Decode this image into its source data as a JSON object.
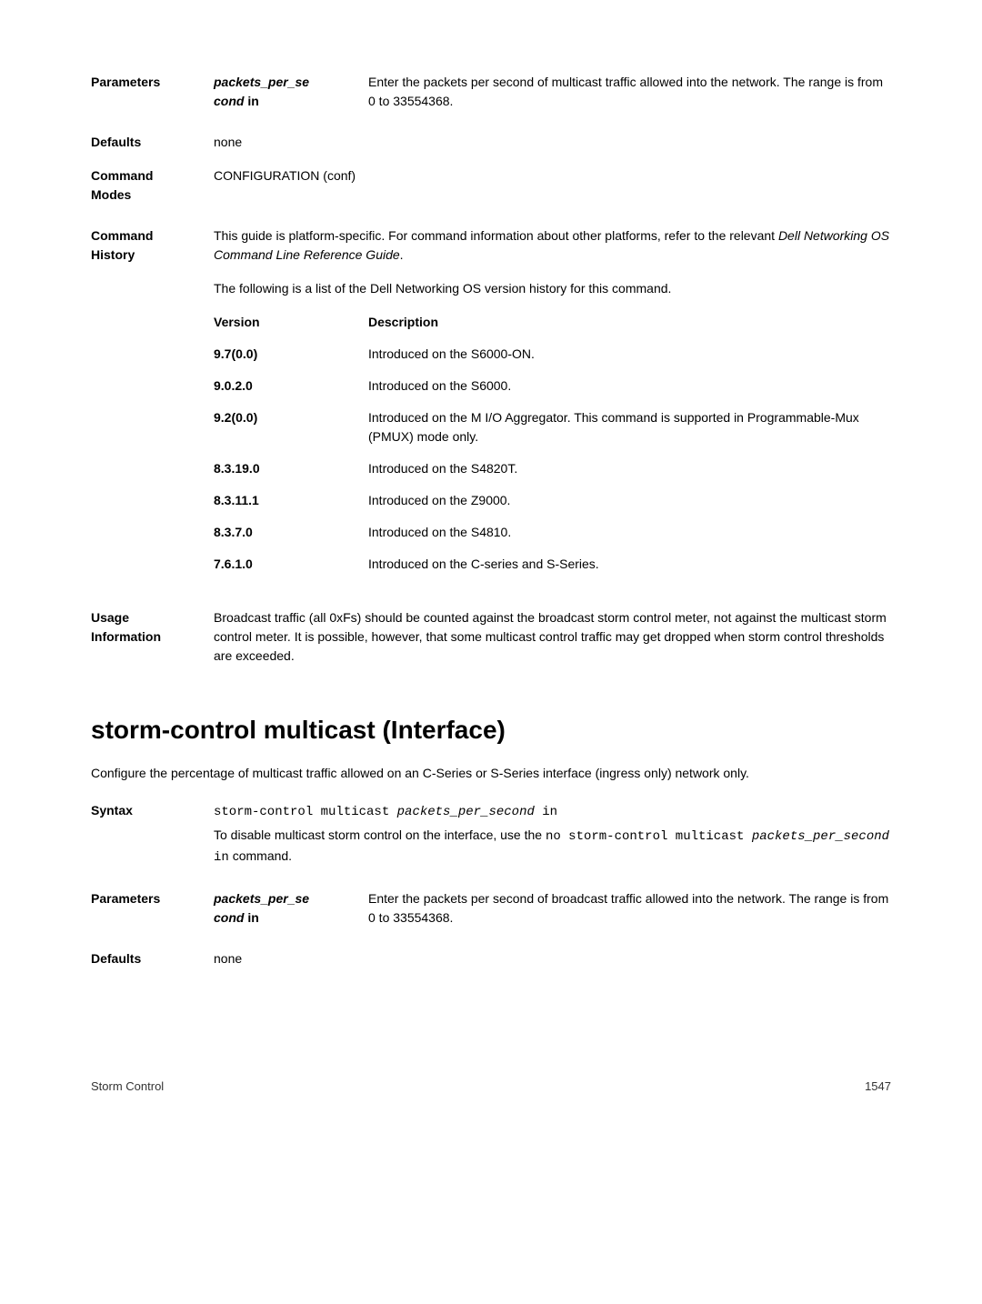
{
  "section1": {
    "parameters": {
      "label": "Parameters",
      "param_name_line1": "packets_per_se",
      "param_name_line2": "cond",
      "param_name_suffix": " in",
      "param_desc": "Enter the packets per second of multicast traffic allowed into the network. The range is from 0 to 33554368."
    },
    "defaults": {
      "label": "Defaults",
      "value": "none"
    },
    "command_modes": {
      "label_line1": "Command",
      "label_line2": "Modes",
      "value": "CONFIGURATION (conf)"
    },
    "command_history": {
      "label_line1": "Command",
      "label_line2": "History",
      "intro1_part1": "This guide is platform-specific. For command information about other platforms, refer to the relevant ",
      "intro1_italic": "Dell Networking OS Command Line Reference Guide",
      "intro1_part2": ".",
      "intro2": "The following is a list of the Dell Networking OS version history for this command.",
      "headers": {
        "version": "Version",
        "description": "Description"
      },
      "rows": [
        {
          "version": "9.7(0.0)",
          "description": "Introduced on the S6000-ON."
        },
        {
          "version": "9.0.2.0",
          "description": "Introduced on the S6000."
        },
        {
          "version": "9.2(0.0)",
          "description": "Introduced on the M I/O Aggregator. This command is supported in Programmable-Mux (PMUX) mode only."
        },
        {
          "version": "8.3.19.0",
          "description": "Introduced on the S4820T."
        },
        {
          "version": "8.3.11.1",
          "description": "Introduced on the Z9000."
        },
        {
          "version": "8.3.7.0",
          "description": "Introduced on the S4810."
        },
        {
          "version": "7.6.1.0",
          "description": "Introduced on the C-series and S-Series."
        }
      ]
    },
    "usage": {
      "label_line1": "Usage",
      "label_line2": "Information",
      "text": "Broadcast traffic (all 0xFs) should be counted against the broadcast storm control meter, not against the multicast storm control meter. It is possible, however, that some multicast control traffic may get dropped when storm control thresholds are exceeded."
    }
  },
  "section2": {
    "heading": "storm-control multicast (Interface)",
    "intro": "Configure the percentage of multicast traffic allowed on an C-Series or S-Series interface (ingress only) network only.",
    "syntax": {
      "label": "Syntax",
      "line1_cmd": "storm-control multicast ",
      "line1_italic": "packets_per_second",
      "line1_suffix": " in",
      "line2_prefix": "To disable multicast storm control on the interface, use the ",
      "line2_code1": "no storm-control multicast ",
      "line2_italic": "packets_per_second",
      "line2_code2": " in",
      "line2_suffix": " command."
    },
    "parameters": {
      "label": "Parameters",
      "param_name_line1": "packets_per_se",
      "param_name_line2": "cond",
      "param_name_suffix": " in",
      "param_desc": "Enter the packets per second of broadcast traffic allowed into the network. The range is from 0 to 33554368."
    },
    "defaults": {
      "label": "Defaults",
      "value": "none"
    }
  },
  "footer": {
    "left": "Storm Control",
    "right": "1547"
  }
}
